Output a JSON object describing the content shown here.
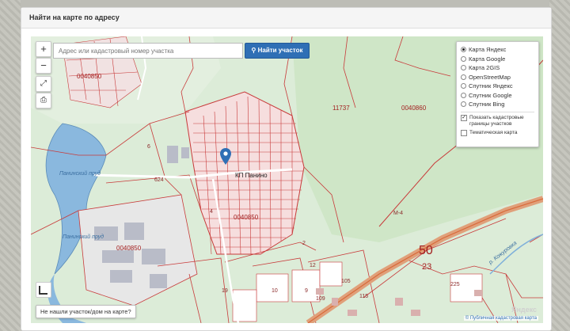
{
  "panel": {
    "title": "Найти на карте по адресу"
  },
  "search": {
    "placeholder": "Адрес или кадастровый номер участка",
    "button_label": "Найти участок"
  },
  "controls": {
    "zoom_in": "+",
    "zoom_out": "−",
    "fullscreen": "⤢",
    "print": "⎙"
  },
  "layers": {
    "options": [
      {
        "label": "Карта Яндекс",
        "selected": true
      },
      {
        "label": "Карта Google",
        "selected": false
      },
      {
        "label": "Карта 2GIS",
        "selected": false
      },
      {
        "label": "OpenStreetMap",
        "selected": false
      },
      {
        "label": "Спутник Яндекс",
        "selected": false
      },
      {
        "label": "Спутник Google",
        "selected": false
      },
      {
        "label": "Спутник Bing",
        "selected": false
      }
    ],
    "checkboxes": [
      {
        "label": "Показать кадастровые границы участков",
        "checked": true
      },
      {
        "label": "Тематическая карта",
        "checked": false
      }
    ]
  },
  "map_labels": {
    "village": "КП Панино",
    "pond": "Панинский пруд",
    "pond2": "Панинский пруд",
    "river": "р. Кожуровка",
    "quarter1": "0040860",
    "quarter2": "0040850",
    "quarter3": "0040850",
    "quarter4": "0040850",
    "big50": "50",
    "big23": "23",
    "n11737": "11737",
    "n624": "624",
    "n6": "6",
    "n4": "4",
    "n2": "2",
    "n19": "19",
    "n12": "12",
    "n10": "10",
    "n9": "9",
    "n105": "105",
    "n225": "225",
    "n109": "109",
    "n115": "115",
    "road": "М-4"
  },
  "not_found_label": "Не нашли участок/дом на карте?",
  "attribution": "© Публичная кадастровая карта",
  "watermark": "Яндекс",
  "colors": {
    "accent": "#2f6fb5",
    "parcel_border": "#c83a3a",
    "water": "#6fa8d6"
  }
}
